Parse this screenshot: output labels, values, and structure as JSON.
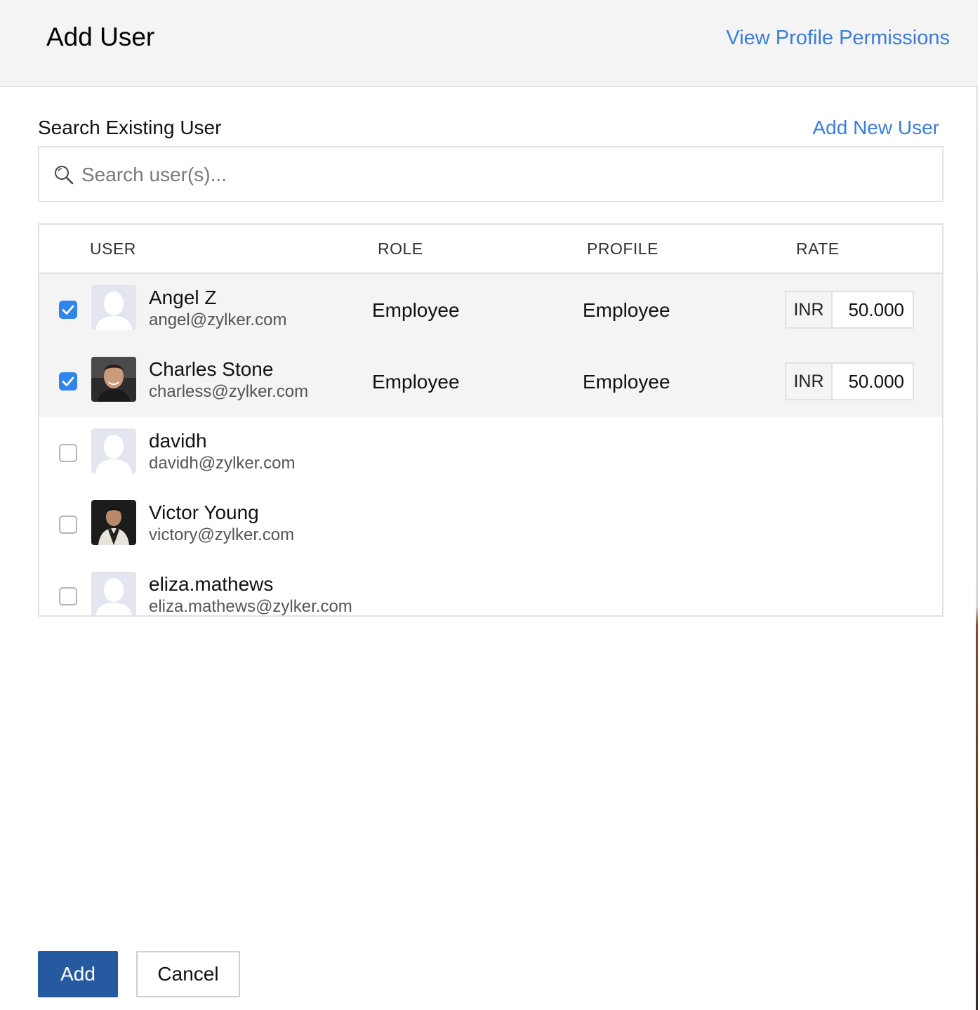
{
  "header": {
    "title": "Add User",
    "view_permissions_link": "View Profile Permissions"
  },
  "search": {
    "label": "Search Existing User",
    "add_new_link": "Add New User",
    "placeholder": "Search user(s)...",
    "value": ""
  },
  "table": {
    "columns": {
      "user": "USER",
      "role": "ROLE",
      "profile": "PROFILE",
      "rate": "RATE"
    },
    "rows": [
      {
        "checked": true,
        "name": "Angel Z",
        "email": "angel@zylker.com",
        "avatar": "default-avatar",
        "role": "Employee",
        "profile": "Employee",
        "currency": "INR",
        "rate": "50.000"
      },
      {
        "checked": true,
        "name": "Charles Stone",
        "email": "charless@zylker.com",
        "avatar": "photo-avatar",
        "role": "Employee",
        "profile": "Employee",
        "currency": "INR",
        "rate": "50.000"
      },
      {
        "checked": false,
        "name": "davidh",
        "email": "davidh@zylker.com",
        "avatar": "default-avatar"
      },
      {
        "checked": false,
        "name": "Victor Young",
        "email": "victory@zylker.com",
        "avatar": "photo-avatar"
      },
      {
        "checked": false,
        "name": "eliza.mathews",
        "email": "eliza.mathews@zylker.com",
        "avatar": "default-avatar"
      }
    ]
  },
  "footer": {
    "add_label": "Add",
    "cancel_label": "Cancel"
  },
  "colors": {
    "link": "#3b7dd8",
    "checkbox_checked": "#2f86e8",
    "primary_button": "#265aa0",
    "header_bg": "#f4f4f4",
    "selected_row_bg": "#f4f4f4"
  },
  "icons": {
    "search": "search-icon",
    "check": "check-icon"
  }
}
